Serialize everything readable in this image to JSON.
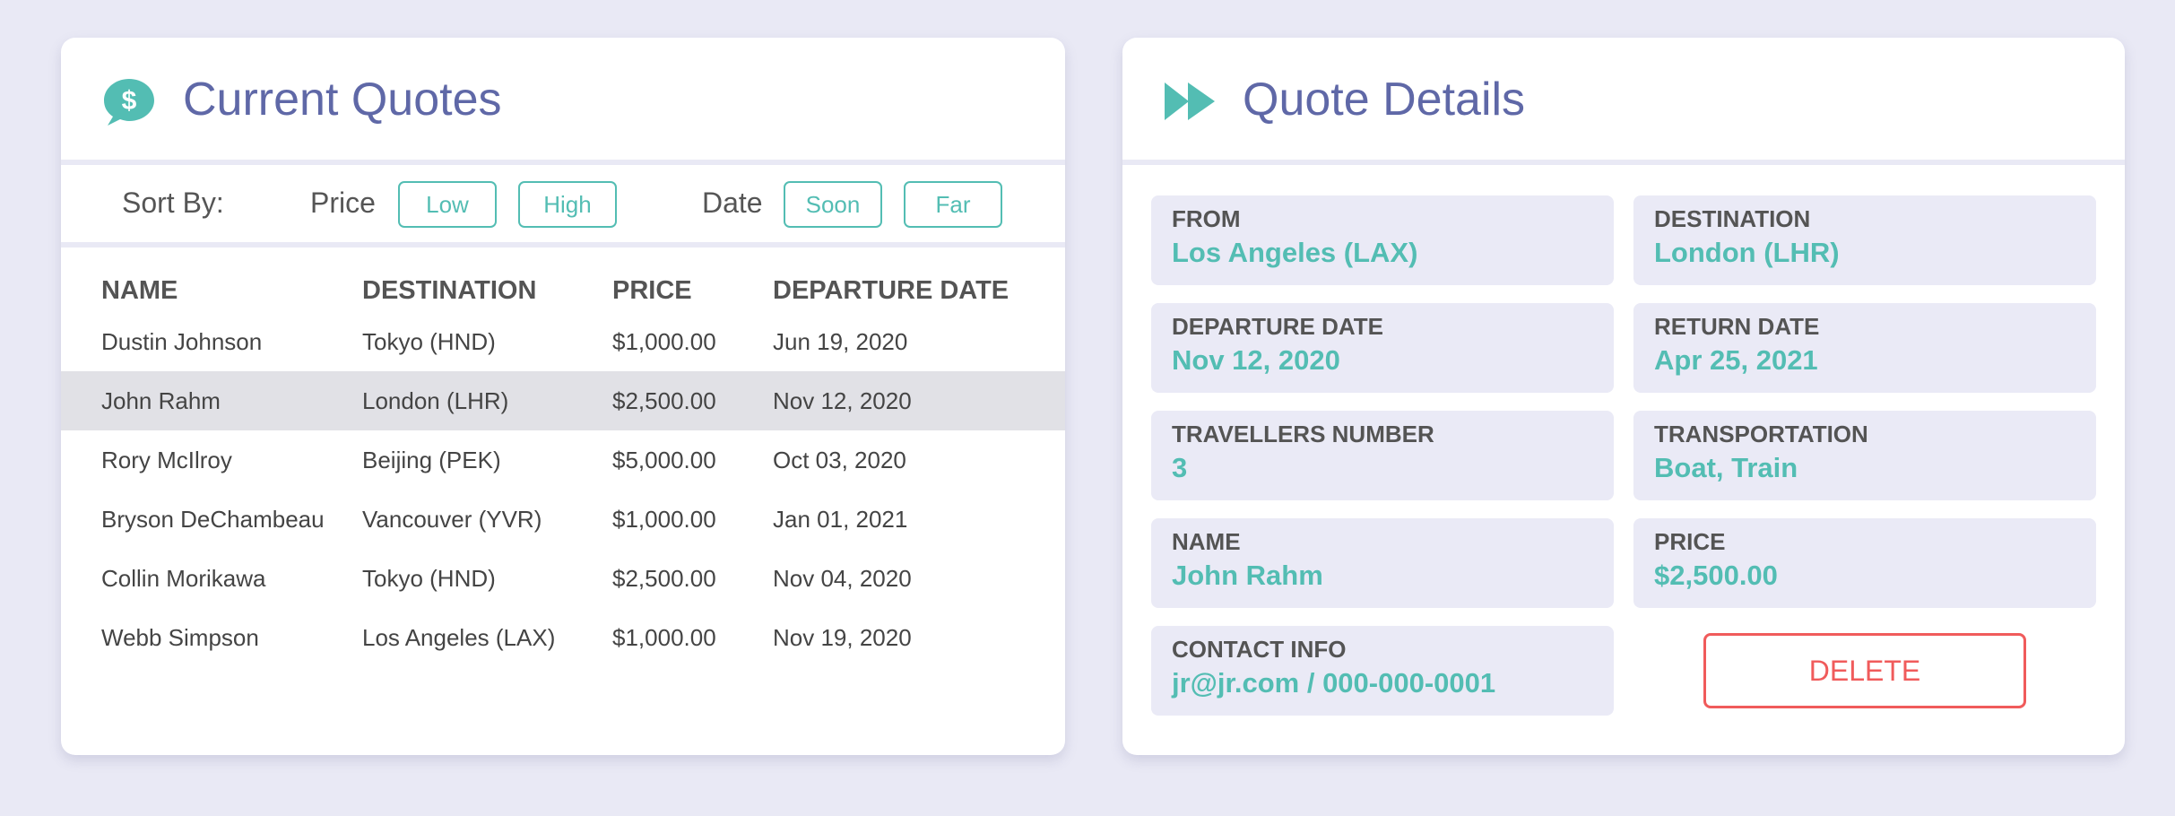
{
  "quotes_panel": {
    "title": "Current Quotes",
    "icon": "dollar-chat-bubble-icon",
    "sort": {
      "label": "Sort By:",
      "price_label": "Price",
      "price_low": "Low",
      "price_high": "High",
      "date_label": "Date",
      "date_soon": "Soon",
      "date_far": "Far"
    },
    "table": {
      "headers": [
        "NAME",
        "DESTINATION",
        "PRICE",
        "DEPARTURE DATE"
      ],
      "rows": [
        [
          "Dustin Johnson",
          "Tokyo (HND)",
          "$1,000.00",
          "Jun 19, 2020"
        ],
        [
          "John Rahm",
          "London (LHR)",
          "$2,500.00",
          "Nov 12, 2020"
        ],
        [
          "Rory McIlroy",
          "Beijing (PEK)",
          "$5,000.00",
          "Oct 03, 2020"
        ],
        [
          "Bryson DeChambeau",
          "Vancouver (YVR)",
          "$1,000.00",
          "Jan 01, 2021"
        ],
        [
          "Collin Morikawa",
          "Tokyo (HND)",
          "$2,500.00",
          "Nov 04, 2020"
        ],
        [
          "Webb Simpson",
          "Los Angeles (LAX)",
          "$1,000.00",
          "Nov 19, 2020"
        ]
      ],
      "selected_row": 1
    }
  },
  "details_panel": {
    "title": "Quote Details",
    "icon": "fast-forward-icon",
    "fields": {
      "from": {
        "label": "FROM",
        "value": "Los Angeles (LAX)"
      },
      "destination": {
        "label": "DESTINATION",
        "value": "London (LHR)"
      },
      "departure_date": {
        "label": "DEPARTURE DATE",
        "value": "Nov 12, 2020"
      },
      "return_date": {
        "label": "RETURN DATE",
        "value": "Apr 25, 2021"
      },
      "travellers": {
        "label": "TRAVELLERS NUMBER",
        "value": "3"
      },
      "transportation": {
        "label": "TRANSPORTATION",
        "value": "Boat, Train"
      },
      "name": {
        "label": "NAME",
        "value": "John Rahm"
      },
      "price": {
        "label": "PRICE",
        "value": "$2,500.00"
      },
      "contact": {
        "label": "CONTACT INFO",
        "value": "jr@jr.com / 000-000-0001"
      }
    },
    "delete_label": "DELETE"
  },
  "colors": {
    "background": "#e9e9f5",
    "title": "#5f68a7",
    "accent_teal": "#53bdb3",
    "danger": "#f05b5b",
    "selected_row": "#e1e1e6",
    "field_bg": "#eaeaf6"
  }
}
